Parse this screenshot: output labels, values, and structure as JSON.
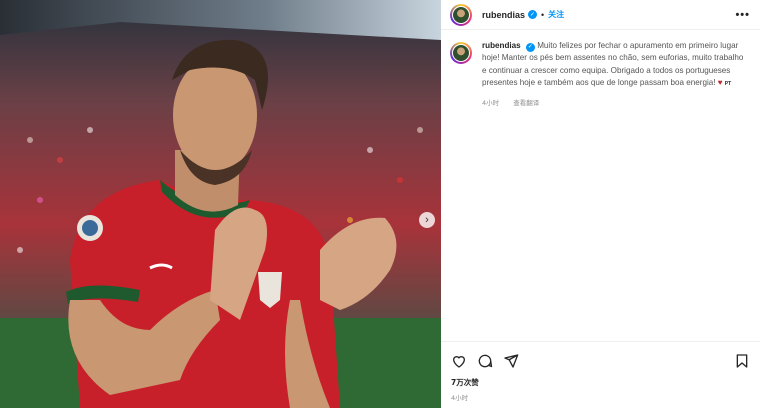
{
  "post": {
    "username": "rubendias",
    "follow_label": "关注",
    "more_label": "•••",
    "caption_username": "rubendias",
    "caption_text": "Muito felizes por fechar o apuramento em primeiro lugar hoje! Manter os pés bem assentes no chão, sem euforias, muito trabalho e continuar a crescer como equipa. Obrigado a todos os portugueses presentes hoje e também aos que de longe passam boa energia!",
    "caption_flag": "PT",
    "caption_age": "4小时",
    "translate_label": "查看翻译",
    "likes_label": "7万次赞",
    "time_label": "4小时"
  },
  "photo": {
    "next_icon": "chevron-right-icon",
    "description_colors": {
      "shirt": "#c8202b",
      "collar": "#1f5a2e",
      "pitch": "#2f6a34"
    }
  },
  "icons": {
    "like": "heart-icon",
    "comment": "comment-icon",
    "share": "send-icon",
    "save": "bookmark-icon"
  },
  "colors": {
    "accent": "#0095f6",
    "text": "#262626",
    "muted": "#8e8e8e"
  }
}
